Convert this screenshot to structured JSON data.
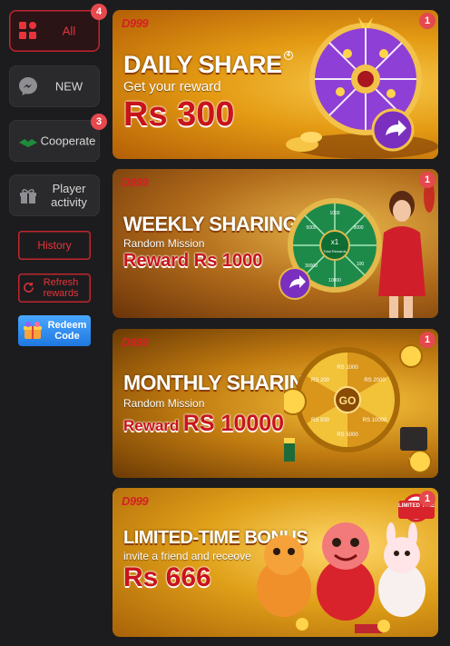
{
  "sidebar": {
    "tabs": [
      {
        "label": "All",
        "badge": "4",
        "icon": "grid-icon",
        "active": true
      },
      {
        "label": "NEW",
        "badge": "",
        "icon": "messenger-icon",
        "active": false
      },
      {
        "label": "Cooperate",
        "badge": "3",
        "icon": "handshake-icon",
        "active": false
      },
      {
        "label": "Player activity",
        "badge": "",
        "icon": "gift-icon",
        "active": false
      }
    ],
    "history_label": "History",
    "refresh_label": "Refresh rewards",
    "redeem_label": "Redeem Code"
  },
  "banners": [
    {
      "brand": "D999",
      "title": "DAILY SHARE",
      "index": "4",
      "subtitle": "Get your reward",
      "reward": "Rs 300",
      "badge": "1"
    },
    {
      "brand": "D999",
      "title": "WEEKLY SHARING",
      "index": "5",
      "subtitle": "Random Mission",
      "reward": "Reward Rs 1000",
      "badge": "1",
      "wheel_center": "x1",
      "wheel_sub": "Total Rewards",
      "wheel_values": [
        "1000",
        "3000",
        "5000",
        "30000",
        "10000",
        "100"
      ]
    },
    {
      "brand": "D999",
      "title": "MONTHLY SHARING",
      "index": "6",
      "subtitle": "Random Mission",
      "reward_prefix": "Reward",
      "reward": "RS 10000",
      "badge": "1",
      "wheel_center": "GO",
      "wheel_values": [
        "RS 1000",
        "RS 2000",
        "RS 10000",
        "RS 5000",
        "RS 500",
        "RS 200"
      ],
      "vip": "VIP"
    },
    {
      "brand": "D999",
      "title": "LIMITED-TIME BONUS",
      "subtitle": "invite a friend and receove",
      "reward": "Rs 666",
      "badge": "1",
      "tag": "LIMITED TIME"
    }
  ],
  "colors": {
    "accent": "#e8333b",
    "badge": "#e5484d",
    "bg": "#1c1c1e"
  }
}
